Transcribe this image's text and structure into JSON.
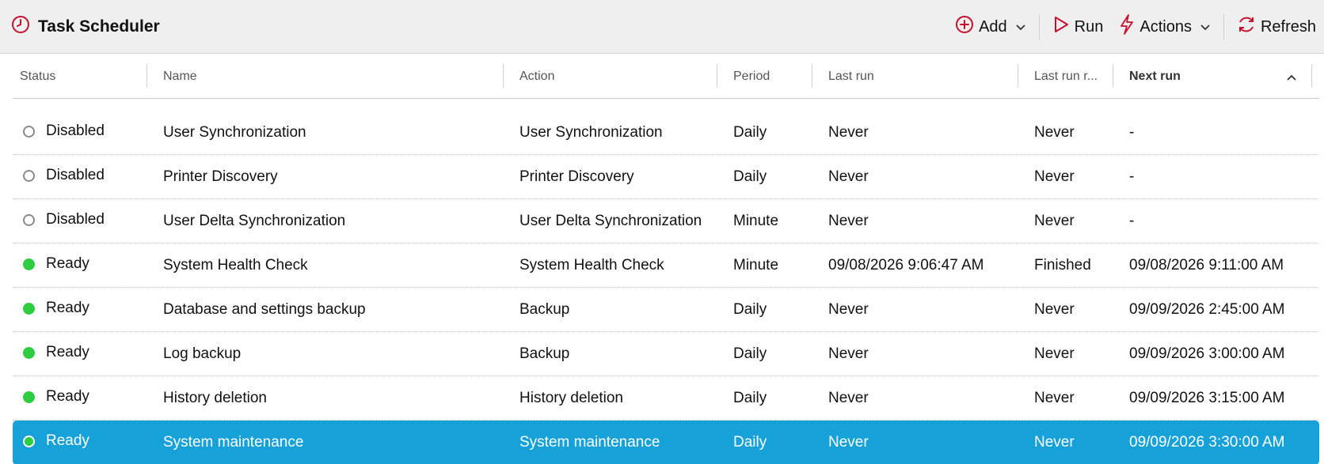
{
  "app": {
    "title": "Task Scheduler"
  },
  "toolbar": {
    "add_label": "Add",
    "run_label": "Run",
    "actions_label": "Actions",
    "refresh_label": "Refresh",
    "icons": [
      "clock-icon",
      "plus-circle-icon",
      "chevron-down-icon",
      "play-icon",
      "lightning-icon",
      "refresh-icon"
    ]
  },
  "colors": {
    "accent": "#c8102e",
    "selection": "#16a1d9",
    "ready": "#2ecc40",
    "disabled": "#8a8a8a",
    "header_bg": "#efefef"
  },
  "columns": {
    "status": "Status",
    "name": "Name",
    "action": "Action",
    "period": "Period",
    "last_run": "Last run",
    "last_run_result": "Last run r...",
    "next_run": "Next run"
  },
  "sort": {
    "column": "next_run",
    "direction": "ascending"
  },
  "rows": [
    {
      "status": "Disabled",
      "state": "disabled",
      "name": "User Synchronization",
      "action": "User Synchronization",
      "period": "Daily",
      "last_run": "Never",
      "last_run_result": "Never",
      "next_run": "-"
    },
    {
      "status": "Disabled",
      "state": "disabled",
      "name": "Printer Discovery",
      "action": "Printer Discovery",
      "period": "Daily",
      "last_run": "Never",
      "last_run_result": "Never",
      "next_run": "-"
    },
    {
      "status": "Disabled",
      "state": "disabled",
      "name": "User Delta Synchronization",
      "action": "User Delta Synchronization",
      "period": "Minute",
      "last_run": "Never",
      "last_run_result": "Never",
      "next_run": "-"
    },
    {
      "status": "Ready",
      "state": "ready",
      "name": "System Health Check",
      "action": "System Health Check",
      "period": "Minute",
      "last_run": "09/08/2026 9:06:47 AM",
      "last_run_result": "Finished",
      "next_run": "09/08/2026 9:11:00 AM"
    },
    {
      "status": "Ready",
      "state": "ready",
      "name": "Database and settings backup",
      "action": "Backup",
      "period": "Daily",
      "last_run": "Never",
      "last_run_result": "Never",
      "next_run": "09/09/2026 2:45:00 AM"
    },
    {
      "status": "Ready",
      "state": "ready",
      "name": "Log backup",
      "action": "Backup",
      "period": "Daily",
      "last_run": "Never",
      "last_run_result": "Never",
      "next_run": "09/09/2026 3:00:00 AM"
    },
    {
      "status": "Ready",
      "state": "ready",
      "name": "History deletion",
      "action": "History deletion",
      "period": "Daily",
      "last_run": "Never",
      "last_run_result": "Never",
      "next_run": "09/09/2026 3:15:00 AM"
    },
    {
      "status": "Ready",
      "state": "ready",
      "name": "System maintenance",
      "action": "System maintenance",
      "period": "Daily",
      "last_run": "Never",
      "last_run_result": "Never",
      "next_run": "09/09/2026 3:30:00 AM",
      "selected": true
    }
  ]
}
